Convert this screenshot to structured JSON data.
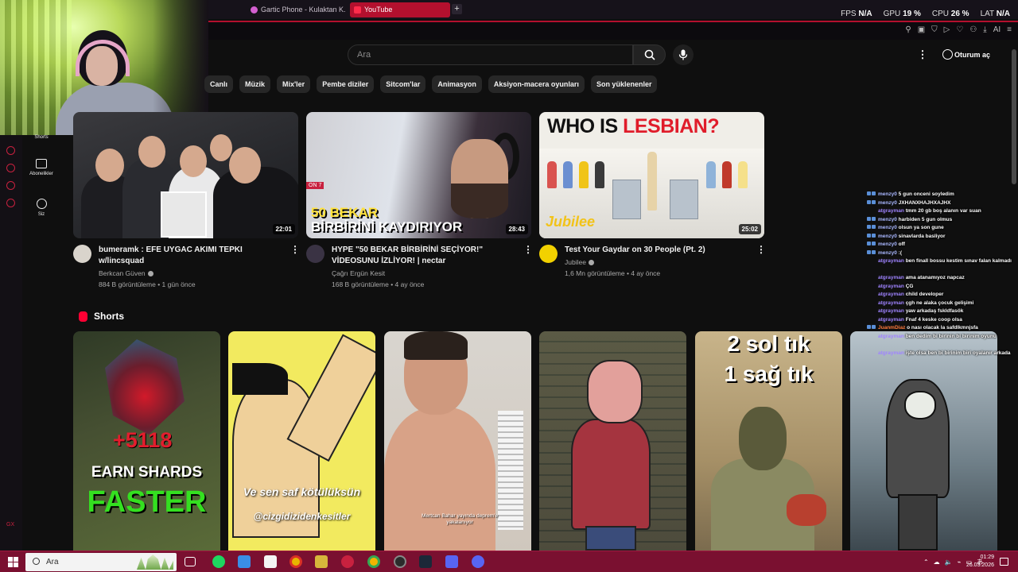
{
  "browser": {
    "tabs": [
      {
        "label": "Gartic Phone - Kulaktan K..."
      },
      {
        "label": "YouTube"
      }
    ],
    "new_tab": "+",
    "stats": [
      {
        "label": "FPS",
        "value": "N/A"
      },
      {
        "label": "GPU",
        "value": "19 %"
      },
      {
        "label": "CPU",
        "value": "26 %"
      },
      {
        "label": "LAT",
        "value": "N/A"
      }
    ],
    "ai_label": "AI",
    "gx_label": "GX"
  },
  "youtube": {
    "search": {
      "placeholder": "Ara"
    },
    "signin_label": "Oturum aç",
    "guide": [
      {
        "label": "Shorts"
      },
      {
        "label": "Abonelikler"
      },
      {
        "label": "Siz"
      }
    ],
    "chips": [
      "Canlı",
      "Müzik",
      "Mix'ler",
      "Pembe diziler",
      "Sitcom'lar",
      "Animasyon",
      "Aksiyon-macera oyunları",
      "Son yüklenenler"
    ],
    "videos": [
      {
        "title": "bumeramk : EFE UYGAC AKIMI TEPKI w/lincsquad",
        "channel": "Berkcan Güven",
        "meta": "884 B görüntüleme • 1 gün önce",
        "duration": "22:01"
      },
      {
        "title": "HYPE \"50 BEKAR BİRBİRİNİ SEÇİYOR!\" VİDEOSUNU İZLİYOR! | nectar",
        "channel": "Çağrı Ergün Kesit",
        "meta": "168 B görüntüleme • 4 ay önce",
        "duration": "28:43",
        "thumb_text_1": "50 BEKAR",
        "thumb_text_2": "BİRBİRİNİ KAYDIRIYOR",
        "thumb_badge": "ON 7"
      },
      {
        "title": "Test Your Gaydar on 30 People (Pt. 2)",
        "channel": "Jubilee",
        "meta": "1,6 Mn görüntüleme • 4 ay önce",
        "duration": "25:02",
        "thumb_text_1": "WHO IS ",
        "thumb_text_2": "LESBIAN?",
        "thumb_brand": "Jubilee"
      }
    ],
    "shorts_heading": "Shorts",
    "shorts": [
      {
        "line1": "+5118",
        "line2": "EARN SHARDS",
        "line3": "FASTER"
      },
      {
        "line1": "Ve sen saf kötülüksün",
        "line2": "@cizgidizidenkesitler"
      },
      {
        "line1": "Mertcan Bahar yayında deprem'e yakalanıyor"
      },
      {},
      {
        "line1": "2 sol tık",
        "line2": "1 sağ tık"
      },
      {}
    ]
  },
  "chat": [
    {
      "user": "menzy0",
      "text": "5 gun onceni soyledim",
      "badges": 2
    },
    {
      "user": "menzy0",
      "text": "JXHANXHAJHXAJHX",
      "badges": 2
    },
    {
      "user": "atgrayman",
      "text": "tmm 20 gb boş alanın var suan",
      "badges": 0
    },
    {
      "user": "menzy0",
      "text": "harbiden 5 gun olmus",
      "badges": 2
    },
    {
      "user": "menzy0",
      "text": "olsun ya son gune",
      "badges": 2
    },
    {
      "user": "menzy0",
      "text": "sinavlarda basliyor",
      "badges": 2
    },
    {
      "user": "menzy0",
      "text": "off",
      "badges": 2
    },
    {
      "user": "menzy0",
      "text": ":(",
      "badges": 2
    },
    {
      "user": "atgrayman",
      "text": "ben finall bossu kestim sınav falan kalmadı",
      "badges": 0
    },
    {
      "user": "atgrayman",
      "text": "ama atanamıyoz napcaz",
      "badges": 0
    },
    {
      "user": "atgrayman",
      "text": "ÇG",
      "badges": 0
    },
    {
      "user": "atgrayman",
      "text": "child developer",
      "badges": 0
    },
    {
      "user": "atgrayman",
      "text": "çgh ne alaka çocuk gelişimi",
      "badges": 0
    },
    {
      "user": "atgrayman",
      "text": "yaw arkadaş fskldfasök",
      "badges": 0
    },
    {
      "user": "atgrayman",
      "text": "Fnaf 4 keske coop olsa",
      "badges": 0
    },
    {
      "user": "JuanmDiaz",
      "text": "o nası olacak la safdlkmnjsfa",
      "badges": 2
    },
    {
      "user": "atgrayman",
      "text": "ben dedim bi birinin bi birinim oyunu",
      "badges": 0
    },
    {
      "user": "atgrayman",
      "text": "işte olsa ben bi birinim biri oyalanır arkada",
      "badges": 0
    }
  ],
  "taskbar": {
    "search_label": "Ara",
    "time": "01:29",
    "date": "26.03.2026"
  },
  "colors": {
    "brand_red": "#ff0033",
    "gx_accent": "#c8213f",
    "taskbar": "#7a1030"
  }
}
